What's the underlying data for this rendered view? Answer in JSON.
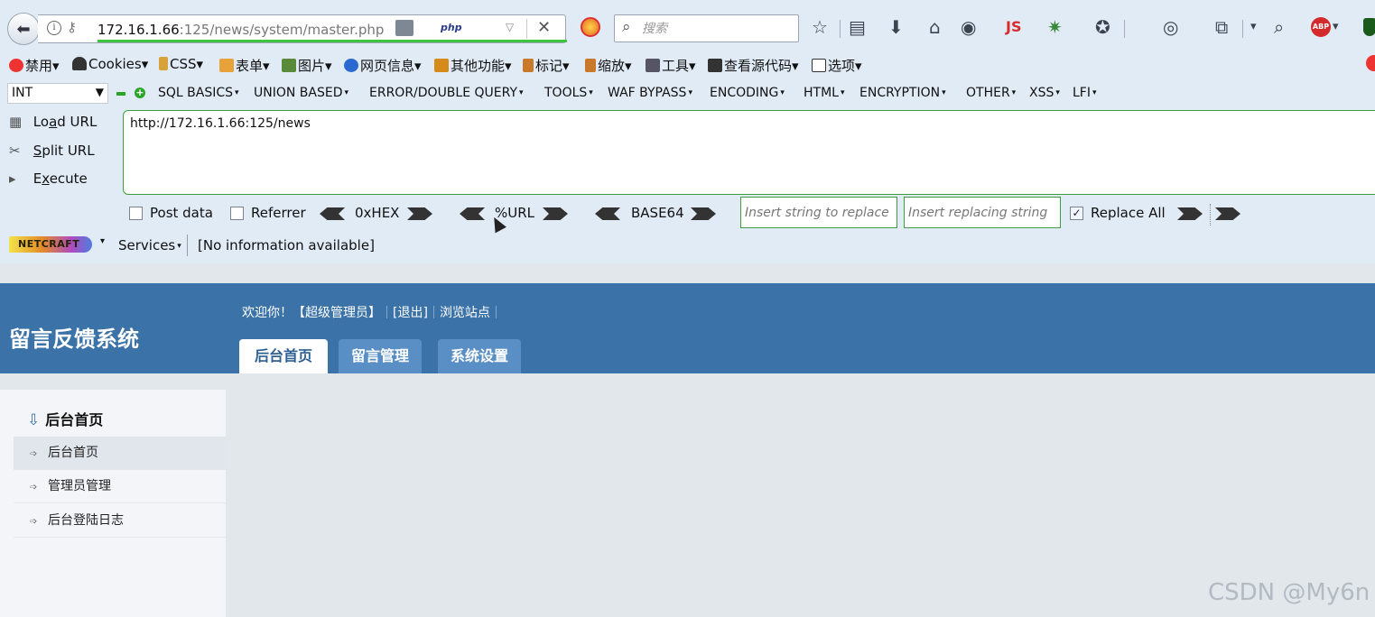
{
  "browser": {
    "url_host": "172.16.1.66",
    "url_rest": ":125/news/system/master.php",
    "php_badge": "php",
    "search_placeholder": "搜索",
    "js_label": "JS",
    "abp_label": "ABP"
  },
  "menubar": {
    "items": [
      "禁用",
      "Cookies",
      "CSS",
      "表单",
      "图片",
      "网页信息",
      "其他功能",
      "标记",
      "缩放",
      "工具",
      "查看源代码",
      "选项"
    ]
  },
  "hackbar": {
    "type_select": "INT",
    "menus": [
      "SQL BASICS",
      "UNION BASED",
      "ERROR/DOUBLE QUERY",
      "TOOLS",
      "WAF BYPASS",
      "ENCODING",
      "HTML",
      "ENCRYPTION",
      "OTHER",
      "XSS",
      "LFI"
    ],
    "actions": {
      "load_pre": "Lo",
      "load_u": "a",
      "load_post": "d URL",
      "split_u": "S",
      "split_post": "plit URL",
      "exec_pre": "E",
      "exec_u": "x",
      "exec_post": "ecute"
    },
    "url_value": "http://172.16.1.66:125/news",
    "options": {
      "post_data": "Post data",
      "referrer": "Referrer",
      "hex": "0xHEX",
      "url_enc": "%URL",
      "base64": "BASE64",
      "replace_from_placeholder": "Insert string to replace",
      "replace_to_placeholder": "Insert replacing string",
      "replace_all": "Replace All",
      "replace_all_checked": true
    }
  },
  "netcraft": {
    "logo": "NETCRAFT",
    "services": "Services",
    "info": "[No information available]"
  },
  "page": {
    "logo": "留言反馈系统",
    "welcome": [
      "欢迎你！【超级管理员】",
      "[退出]",
      "浏览站点"
    ],
    "tabs": [
      "后台首页",
      "留言管理",
      "系统设置"
    ],
    "sidebar_title": "后台首页",
    "sidebar_items": [
      "后台首页",
      "管理员管理",
      "后台登陆日志"
    ],
    "colors": {
      "header": "#3b72a8",
      "tab_inactive": "#5a8fc6"
    }
  },
  "watermark": "CSDN @My6n"
}
